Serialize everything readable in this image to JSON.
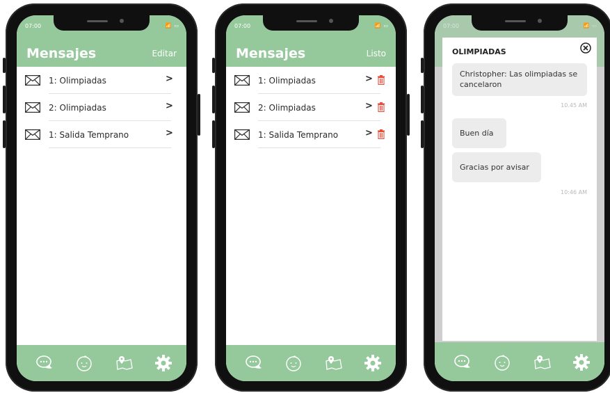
{
  "colors": {
    "header": "#95c99c",
    "delete": "#e74c3c"
  },
  "status": {
    "time": "07:00",
    "icons": "📶 ▭"
  },
  "phone1": {
    "title": "Mensajes",
    "action": "Editar",
    "items": [
      {
        "label": "1: Olimpiadas"
      },
      {
        "label": "2: Olimpiadas"
      },
      {
        "label": "1: Salida Temprano"
      }
    ]
  },
  "phone2": {
    "title": "Mensajes",
    "action": "Listo",
    "items": [
      {
        "label": "1: Olimpiadas"
      },
      {
        "label": "2: Olimpiadas"
      },
      {
        "label": "1: Salida Temprano"
      }
    ]
  },
  "phone3": {
    "modal": {
      "title": "OLIMPIADAS",
      "messages": [
        {
          "text": "Christopher: Las olimpiadas se cancelaron"
        },
        {
          "time": "10.45 AM"
        },
        {
          "text": "Buen día"
        },
        {
          "text": "Gracias por avisar"
        },
        {
          "time": "10:46 AM"
        }
      ]
    }
  },
  "tabs": [
    "chat-icon",
    "baby-face-icon",
    "map-pin-icon",
    "gear-icon"
  ]
}
